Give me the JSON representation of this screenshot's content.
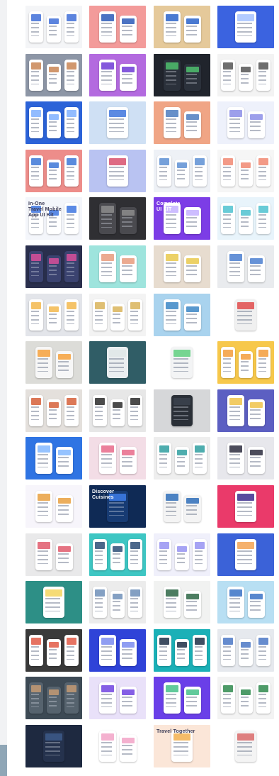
{
  "gallery": {
    "tiles": [
      {
        "bg": "#f4f5f7",
        "accent": "#3f6fd8",
        "fg": "#ffffff",
        "phones": 3
      },
      {
        "bg": "#f39b9a",
        "accent": "#2c5bb8",
        "fg": "#ffffff",
        "phones": 2
      },
      {
        "bg": "#e5c99a",
        "accent": "#2a63c9",
        "fg": "#ffffff",
        "phones": 2
      },
      {
        "bg": "#3b63e0",
        "accent": "#a7c3ff",
        "fg": "#ffffff",
        "phones": 1
      },
      {
        "bg": "#8d96a6",
        "accent": "#c98553",
        "fg": "#ffffff",
        "phones": 3
      },
      {
        "bg": "#b36adf",
        "accent": "#6d3bd6",
        "fg": "#ffffff",
        "phones": 2
      },
      {
        "bg": "#20242c",
        "accent": "#4fbf6e",
        "fg": "#2b313b",
        "phones": 2
      },
      {
        "bg": "#f3f3f3",
        "accent": "#555555",
        "fg": "#ffffff",
        "phones": 3
      },
      {
        "bg": "#2c63d8",
        "accent": "#7fb0ff",
        "fg": "#ffffff",
        "phones": 3
      },
      {
        "bg": "#cfe0f4",
        "accent": "#3f75dd",
        "fg": "#ffffff",
        "phones": 1
      },
      {
        "bg": "#f0a585",
        "accent": "#4c7dc0",
        "fg": "#ffffff",
        "phones": 2
      },
      {
        "bg": "#eef1fb",
        "accent": "#8c8ee8",
        "fg": "#ffffff",
        "phones": 2
      },
      {
        "bg": "#ed8d8a",
        "accent": "#3d77d7",
        "fg": "#ffffff",
        "phones": 3
      },
      {
        "bg": "#b9c3f2",
        "accent": "#d8506d",
        "fg": "#ffffff",
        "phones": 1
      },
      {
        "bg": "#eef1f6",
        "accent": "#5d8fd4",
        "fg": "#ffffff",
        "phones": 3
      },
      {
        "bg": "#f6f6f6",
        "accent": "#f18872",
        "fg": "#ffffff",
        "phones": 3
      },
      {
        "bg": "#f4f6fb",
        "accent": "#3e76e0",
        "fg": "#ffffff",
        "phones": 3,
        "text": [
          "In-One",
          "Travel Mobile",
          "App UI Kit"
        ],
        "textColor": "#3a3a55"
      },
      {
        "bg": "#2f2f33",
        "accent": "#8c8c8c",
        "fg": "#4a4a4f",
        "phones": 2
      },
      {
        "bg": "#7c3de6",
        "accent": "#c4b2ff",
        "fg": "#ffffff",
        "phones": 2,
        "text": [
          "Complete",
          "UI KIT"
        ],
        "textColor": "#ffffff"
      },
      {
        "bg": "#e8f4fb",
        "accent": "#4fc2d0",
        "fg": "#ffffff",
        "phones": 3
      },
      {
        "bg": "#2a2f4d",
        "accent": "#d94f9a",
        "fg": "#3b4370",
        "phones": 3
      },
      {
        "bg": "#9ee4dd",
        "accent": "#e89b7c",
        "fg": "#ffffff",
        "phones": 2
      },
      {
        "bg": "#e7dccf",
        "accent": "#e9c94c",
        "fg": "#ffffff",
        "phones": 2
      },
      {
        "bg": "#e9ebee",
        "accent": "#4b7fd0",
        "fg": "#ffffff",
        "phones": 2
      },
      {
        "bg": "#e3e5ea",
        "accent": "#f3b84e",
        "fg": "#ffffff",
        "phones": 3
      },
      {
        "bg": "#f3f3f3",
        "accent": "#d9b45a",
        "fg": "#ffffff",
        "phones": 3
      },
      {
        "bg": "#a9d3ee",
        "accent": "#3b86c6",
        "fg": "#ffffff",
        "phones": 2
      },
      {
        "bg": "#ffffff",
        "accent": "#e04b4b",
        "fg": "#f0f0f0",
        "phones": 1
      },
      {
        "bg": "#dcdcd8",
        "accent": "#f6a13c",
        "fg": "#f7f7f7",
        "phones": 2
      },
      {
        "bg": "#305d66",
        "accent": "#dfe6e8",
        "fg": "#eaeef0",
        "phones": 1
      },
      {
        "bg": "#ffffff",
        "accent": "#5fcf7f",
        "fg": "#f3f4f5",
        "phones": 1
      },
      {
        "bg": "#f7c84b",
        "accent": "#f39c3b",
        "fg": "#ffffff",
        "phones": 3
      },
      {
        "bg": "#e4e0dc",
        "accent": "#d6603a",
        "fg": "#ffffff",
        "phones": 3
      },
      {
        "bg": "#e7e7e7",
        "accent": "#2c2c2c",
        "fg": "#ffffff",
        "phones": 3
      },
      {
        "bg": "#d6d7d9",
        "accent": "#3b424d",
        "fg": "#2a2f37",
        "phones": 1
      },
      {
        "bg": "#5c5fc2",
        "accent": "#f0c34a",
        "fg": "#ffffff",
        "phones": 2
      },
      {
        "bg": "#2f74e3",
        "accent": "#84b8ff",
        "fg": "#ffffff",
        "phones": 2
      },
      {
        "bg": "#f3dde6",
        "accent": "#e86a8a",
        "fg": "#ffffff",
        "phones": 2
      },
      {
        "bg": "#eeeeee",
        "accent": "#2f9fa0",
        "fg": "#ffffff",
        "phones": 3
      },
      {
        "bg": "#e7e7ec",
        "accent": "#2b2b3e",
        "fg": "#ffffff",
        "phones": 2
      },
      {
        "bg": "#f7f5fb",
        "accent": "#e9a03f",
        "fg": "#ffffff",
        "phones": 2
      },
      {
        "bg": "#0f2a55",
        "accent": "#3d7ce8",
        "fg": "#173b73",
        "phones": 1,
        "text": [
          "Discover",
          "Cuisines"
        ],
        "textColor": "#ffffff"
      },
      {
        "bg": "#ffffff",
        "accent": "#2e6db8",
        "fg": "#f4f4f4",
        "phones": 2
      },
      {
        "bg": "#ea3a6a",
        "accent": "#3b2b8e",
        "fg": "#ffffff",
        "phones": 1
      },
      {
        "bg": "#e9e9ea",
        "accent": "#e05a6c",
        "fg": "#ffffff",
        "phones": 2
      },
      {
        "bg": "#3ec6c3",
        "accent": "#2d4e77",
        "fg": "#ffffff",
        "phones": 3
      },
      {
        "bg": "#f0f0fb",
        "accent": "#9793f2",
        "fg": "#ffffff",
        "phones": 3
      },
      {
        "bg": "#3b62d8",
        "accent": "#f3a354",
        "fg": "#ffffff",
        "phones": 1
      },
      {
        "bg": "#2d8f86",
        "accent": "#f3d55e",
        "fg": "#ffffff",
        "phones": 1
      },
      {
        "bg": "#ececec",
        "accent": "#6e8fb8",
        "fg": "#ffffff",
        "phones": 3
      },
      {
        "bg": "#f1f2f1",
        "accent": "#2d6645",
        "fg": "#ffffff",
        "phones": 2
      },
      {
        "bg": "#b8dff3",
        "accent": "#3a72c6",
        "fg": "#ffffff",
        "phones": 2
      },
      {
        "bg": "#3a3a3a",
        "accent": "#e25b47",
        "fg": "#ffffff",
        "phones": 3
      },
      {
        "bg": "#2f43d8",
        "accent": "#7b8cf0",
        "fg": "#ffffff",
        "phones": 2
      },
      {
        "bg": "#1bb0b7",
        "accent": "#1d2f46",
        "fg": "#ffffff",
        "phones": 3
      },
      {
        "bg": "#e6e9ee",
        "accent": "#4b78c6",
        "fg": "#ffffff",
        "phones": 3
      },
      {
        "bg": "#3d4a55",
        "accent": "#c39a74",
        "fg": "#56636e",
        "phones": 3
      },
      {
        "bg": "#e9e1f9",
        "accent": "#7043e0",
        "fg": "#ffffff",
        "phones": 2
      },
      {
        "bg": "#6a3fe8",
        "accent": "#47c18a",
        "fg": "#ffffff",
        "phones": 2
      },
      {
        "bg": "#f3f3f3",
        "accent": "#2f8a4e",
        "fg": "#ffffff",
        "phones": 3
      },
      {
        "bg": "#1e2940",
        "accent": "#3d5b8a",
        "fg": "#25324d",
        "phones": 1
      },
      {
        "bg": "#ffffff",
        "accent": "#f2a3c7",
        "fg": "#ffffff",
        "phones": 2
      },
      {
        "bg": "#fbe6d8",
        "accent": "#f3b04d",
        "fg": "#ffffff",
        "phones": 1,
        "text": [
          "Travel Together"
        ],
        "textColor": "#3a3a55"
      },
      {
        "bg": "#ffffff",
        "accent": "#d96a6a",
        "fg": "#f4f4f4",
        "phones": 1
      }
    ]
  }
}
